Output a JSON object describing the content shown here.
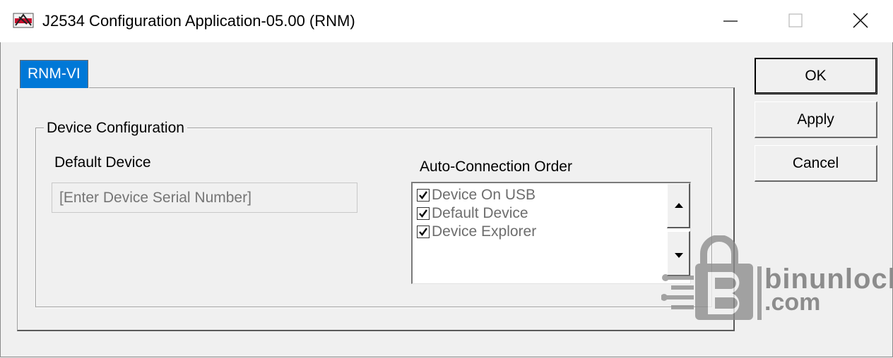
{
  "window": {
    "title": "J2534 Configuration Application-05.00 (RNM)",
    "app_icon": "dashboard-logo-icon",
    "controls": [
      "minimize-icon",
      "maximize-icon",
      "close-icon"
    ]
  },
  "tabs": [
    {
      "label": "RNM-VI",
      "selected": true
    }
  ],
  "device_configuration": {
    "group_title": "Device Configuration",
    "default_device": {
      "label": "Default Device",
      "placeholder": "[Enter Device Serial Number]"
    },
    "auto_connection": {
      "label": "Auto-Connection Order",
      "items": [
        {
          "label": "Device On USB",
          "checked": true
        },
        {
          "label": "Default Device",
          "checked": true
        },
        {
          "label": "Device Explorer",
          "checked": true
        }
      ]
    }
  },
  "buttons": {
    "ok": "OK",
    "apply": "Apply",
    "cancel": "Cancel"
  },
  "watermark": {
    "line1": "binunlock",
    "line2": ".com"
  },
  "colors": {
    "tab_selected": "#0078d7",
    "background": "#f0f0f0"
  }
}
